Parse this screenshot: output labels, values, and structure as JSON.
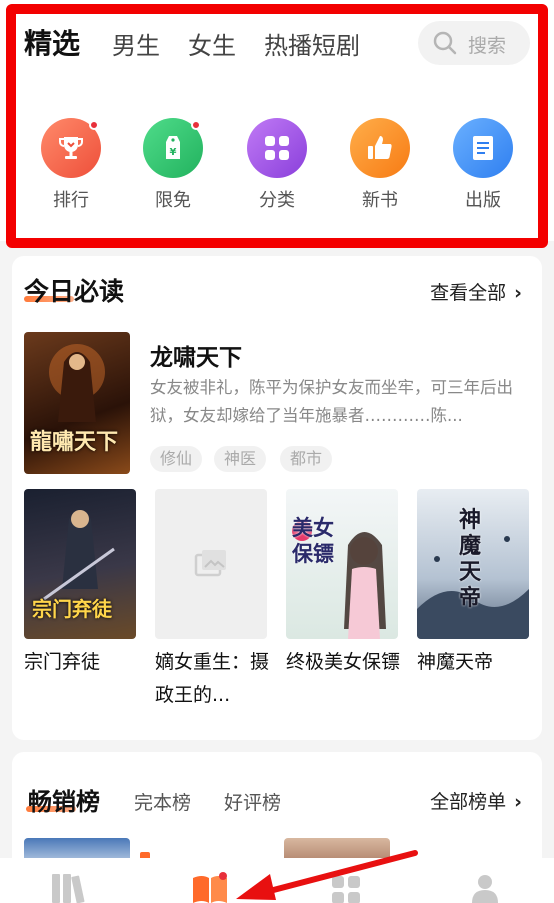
{
  "header": {
    "tabs": [
      "精选",
      "男生",
      "女生",
      "热播短剧"
    ],
    "search_placeholder": "搜索"
  },
  "categories": [
    {
      "label": "排行",
      "icon": "trophy-icon",
      "color": "#f0613f"
    },
    {
      "label": "限免",
      "icon": "price-tag-icon",
      "color": "#2fc26b"
    },
    {
      "label": "分类",
      "icon": "grid-icon",
      "color": "#9b4fe0"
    },
    {
      "label": "新书",
      "icon": "thumbs-up-icon",
      "color": "#fb8a1c"
    },
    {
      "label": "出版",
      "icon": "book-icon",
      "color": "#3d8ef5"
    }
  ],
  "today": {
    "title": "今日必读",
    "see_all": "查看全部",
    "featured": {
      "title": "龙啸天下",
      "description": "女友被非礼，陈平为保护女友而坐牢，可三年后出狱，女友却嫁给了当年施暴者…………陈...",
      "tags": [
        "修仙",
        "神医",
        "都市"
      ],
      "cover_text": "龍嘯天下"
    },
    "books": [
      {
        "name": "宗门弃徒",
        "cover_text": "宗门弃徒"
      },
      {
        "name": "嫡女重生：摄政王的...",
        "cover_text": ""
      },
      {
        "name": "终极美女保镖",
        "cover_text": "美女保镖"
      },
      {
        "name": "神魔天帝",
        "cover_text": "神魔天帝"
      }
    ]
  },
  "bestseller": {
    "tabs": [
      "畅销榜",
      "完本榜",
      "好评榜"
    ],
    "all": "全部榜单"
  },
  "bottom_nav": [
    "bookshelf-icon",
    "bookstore-icon",
    "category-icon",
    "profile-icon"
  ]
}
